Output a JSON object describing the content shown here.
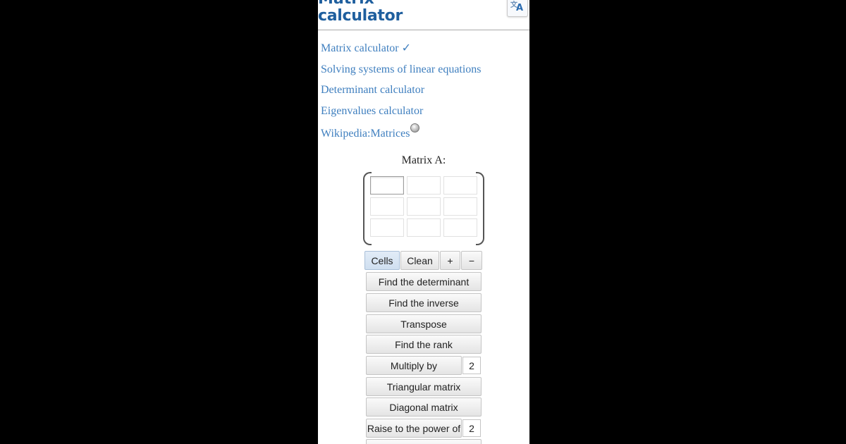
{
  "header": {
    "title_partial": "Matrix",
    "title": "calculator",
    "translate_icon": "translate-icon"
  },
  "links": [
    {
      "label": "Matrix calculator ✓"
    },
    {
      "label": "Solving systems of linear equations"
    },
    {
      "label": "Determinant calculator"
    },
    {
      "label": "Eigenvalues calculator"
    },
    {
      "label": "Wikipedia:Matrices",
      "icon": "wikipedia-icon"
    }
  ],
  "matrix": {
    "label": "Matrix A:",
    "rows": 3,
    "cols": 3,
    "values": [
      [
        "",
        "",
        ""
      ],
      [
        "",
        "",
        ""
      ],
      [
        "",
        "",
        ""
      ]
    ]
  },
  "controls": {
    "cells": "Cells",
    "clean": "Clean",
    "plus": "+",
    "minus": "−"
  },
  "actions": {
    "determinant": "Find the determinant",
    "inverse": "Find the inverse",
    "transpose": "Transpose",
    "rank": "Find the rank",
    "multiply": "Multiply by",
    "multiply_value": "2",
    "triangular": "Triangular matrix",
    "diagonal": "Diagonal matrix",
    "power": "Raise to the power of",
    "power_value": "2"
  },
  "colors": {
    "link": "#3f7fbf",
    "title": "#1f5f9e",
    "outer_background": "#000000"
  }
}
